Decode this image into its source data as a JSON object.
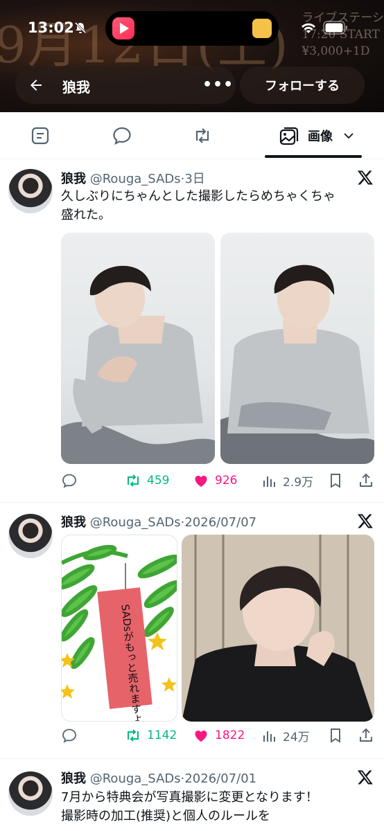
{
  "status_bar": {
    "time": "13:02"
  },
  "banner": {
    "date_text": "9月12日(土)",
    "info_lines": [
      "ライブステーシ",
      "17:20  START",
      "¥3,000+1D"
    ]
  },
  "header": {
    "profile_name": "狼我",
    "follow_label": "フォローする",
    "more_label": "•••"
  },
  "tabs": {
    "media_label": "画像"
  },
  "posts": [
    {
      "name": "狼我",
      "handle": "@Rouga_SADs",
      "time": "3日",
      "text_lines": [
        "久しぶりにちゃんとした撮影したらめちゃくちゃ",
        "盛れた。"
      ],
      "retweets": "459",
      "likes": "926",
      "views": "2.9万"
    },
    {
      "name": "狼我",
      "handle": "@Rouga_SADs",
      "time": "2026/07/07",
      "tanzaku_text": "SADsがもっと売れますように。",
      "retweets": "1142",
      "likes": "1822",
      "views": "24万"
    },
    {
      "name": "狼我",
      "handle": "@Rouga_SADs",
      "time": "2026/07/01",
      "text_lines": [
        "7月から特典会が写真撮影に変更となります！",
        "撮影時の加工(推奨)と個人のルールを"
      ]
    }
  ],
  "colors": {
    "retweet": "#00ba7c",
    "like": "#f91880",
    "secondary": "#536471"
  }
}
